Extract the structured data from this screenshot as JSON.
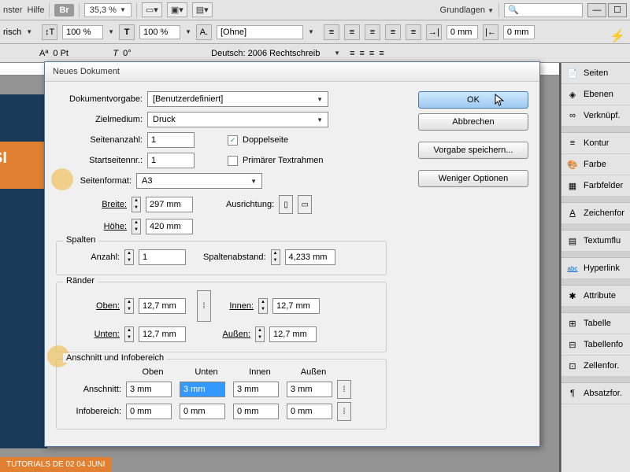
{
  "topbar": {
    "menu_fenster": "nster",
    "menu_hilfe": "Hilfe",
    "br": "Br",
    "zoom": "35,3 %",
    "workspace": "Grundlagen"
  },
  "ctrlbar": {
    "lang_suffix": "risch",
    "pct1": "100 %",
    "pct2": "100 %",
    "style": "[Ohne]",
    "gutter1": "0 mm",
    "gutter2": "0 mm",
    "pt": "0 Pt",
    "angle": "0°",
    "dict": "Deutsch: 2006 Rechtschreib"
  },
  "panels": {
    "items": [
      {
        "icon": "📄",
        "label": "Seiten"
      },
      {
        "icon": "◈",
        "label": "Ebenen"
      },
      {
        "icon": "∞",
        "label": "Verknüpf."
      }
    ],
    "items2": [
      {
        "icon": "≡",
        "label": "Kontur"
      },
      {
        "icon": "🎨",
        "label": "Farbe"
      },
      {
        "icon": "▦",
        "label": "Farbfelder"
      }
    ],
    "items3": [
      {
        "icon": "A",
        "label": "Zeichenfor"
      }
    ],
    "items4": [
      {
        "icon": "▤",
        "label": "Textumflu"
      }
    ],
    "items5": [
      {
        "icon": "abc",
        "label": "Hyperlink"
      }
    ],
    "items6": [
      {
        "icon": "✱",
        "label": "Attribute"
      }
    ],
    "items7": [
      {
        "icon": "⊞",
        "label": "Tabelle"
      },
      {
        "icon": "⊟",
        "label": "Tabellenfo"
      },
      {
        "icon": "⊡",
        "label": "Zellenfor."
      }
    ],
    "items8": [
      {
        "icon": "¶",
        "label": "Absatzfor."
      }
    ]
  },
  "dialog": {
    "title": "Neues Dokument",
    "preset_label": "Dokumentvorgabe:",
    "preset_value": "[Benutzerdefiniert]",
    "intent_label": "Zielmedium:",
    "intent_value": "Druck",
    "pages_label": "Seitenanzahl:",
    "pages_value": "1",
    "facing_label": "Doppelseite",
    "startpage_label": "Startseitennr.:",
    "startpage_value": "1",
    "primarytext_label": "Primärer Textrahmen",
    "pagesize_label": "Seitenformat:",
    "pagesize_value": "A3",
    "width_label": "Breite:",
    "width_value": "297 mm",
    "height_label": "Höhe:",
    "height_value": "420 mm",
    "orient_label": "Ausrichtung:",
    "columns_title": "Spalten",
    "col_count_label": "Anzahl:",
    "col_count_value": "1",
    "col_gutter_label": "Spaltenabstand:",
    "col_gutter_value": "4,233 mm",
    "margins_title": "Ränder",
    "m_top_label": "Oben:",
    "m_top": "12,7 mm",
    "m_bottom_label": "Unten:",
    "m_bottom": "12,7 mm",
    "m_inside_label": "Innen:",
    "m_inside": "12,7 mm",
    "m_outside_label": "Außen:",
    "m_outside": "12,7 mm",
    "bleed_title": "Anschnitt und Infobereich",
    "col_top": "Oben",
    "col_bottom": "Unten",
    "col_inside": "Innen",
    "col_outside": "Außen",
    "bleed_label": "Anschnitt:",
    "bleed_top": "3 mm",
    "bleed_bottom": "3 mm",
    "bleed_inside": "3 mm",
    "bleed_outside": "3 mm",
    "slug_label": "Infobereich:",
    "slug_top": "0 mm",
    "slug_bottom": "0 mm",
    "slug_inside": "0 mm",
    "slug_outside": "0 mm",
    "btn_ok": "OK",
    "btn_cancel": "Abbrechen",
    "btn_save": "Vorgabe speichern...",
    "btn_less": "Weniger Optionen"
  },
  "footer": "TUTORIALS DE     02   04   JUNI",
  "preview": {
    "orange": "SI"
  }
}
